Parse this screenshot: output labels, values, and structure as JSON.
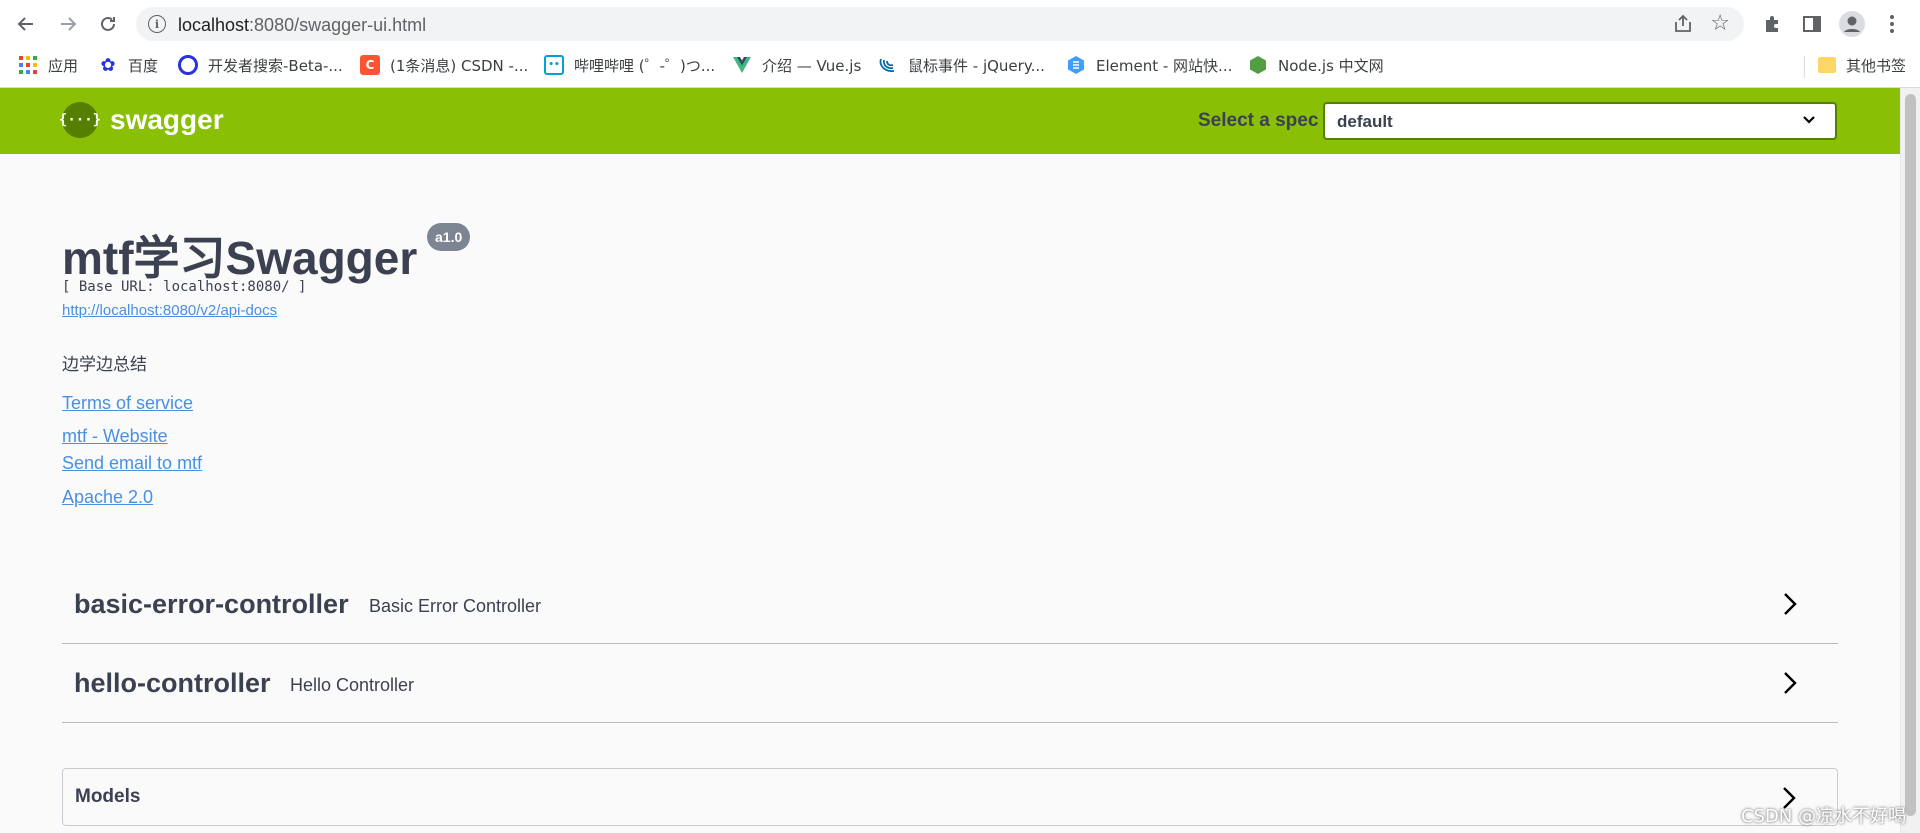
{
  "browser": {
    "url_host": "localhost",
    "url_path": ":8080/swagger-ui.html",
    "bookmarks": [
      {
        "label": "应用",
        "color": "#e8453c"
      },
      {
        "label": "百度",
        "color": "#2932e1"
      },
      {
        "label": "开发者搜索-Beta-...",
        "color": "#1a73e8"
      },
      {
        "label": "(1条消息) CSDN -...",
        "color": "#fc5531"
      },
      {
        "label": "哔哩哔哩 (゜-゜)つ...",
        "color": "#00a1d6"
      },
      {
        "label": "介绍 — Vue.js",
        "color": "#41b883"
      },
      {
        "label": "鼠标事件 - jQuery...",
        "color": "#0769ad"
      },
      {
        "label": "Element - 网站快...",
        "color": "#409eff"
      },
      {
        "label": "Node.js 中文网",
        "color": "#539e43"
      }
    ],
    "other_bookmarks": "其他书签"
  },
  "topbar": {
    "logo_mark": "{···}",
    "logo_text": "swagger",
    "spec_label": "Select a spec",
    "spec_value": "default",
    "accent": "#89bf04"
  },
  "info": {
    "title": "mtf学习Swagger",
    "version": "a1.0",
    "base_url": "[ Base URL: localhost:8080/ ]",
    "api_docs": "http://localhost:8080/v2/api-docs",
    "description": "边学边总结",
    "terms": "Terms of service",
    "website": "mtf - Website",
    "email": "Send email to mtf",
    "license": "Apache 2.0"
  },
  "controllers": [
    {
      "name": "basic-error-controller",
      "description": "Basic Error Controller"
    },
    {
      "name": "hello-controller",
      "description": "Hello Controller"
    }
  ],
  "models": {
    "title": "Models"
  },
  "watermark": "CSDN @凉水不好喝"
}
